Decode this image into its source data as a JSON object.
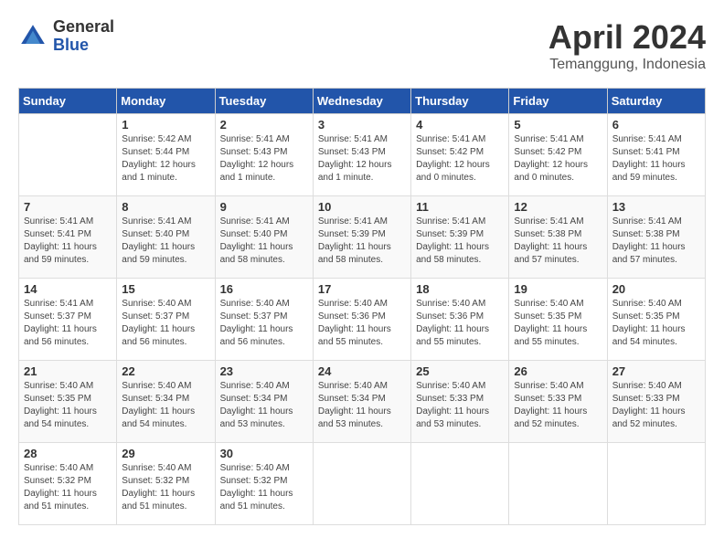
{
  "header": {
    "logo_general": "General",
    "logo_blue": "Blue",
    "month_title": "April 2024",
    "location": "Temanggung, Indonesia"
  },
  "calendar": {
    "days_of_week": [
      "Sunday",
      "Monday",
      "Tuesday",
      "Wednesday",
      "Thursday",
      "Friday",
      "Saturday"
    ],
    "weeks": [
      [
        {
          "day": "",
          "sunrise": "",
          "sunset": "",
          "daylight": ""
        },
        {
          "day": "1",
          "sunrise": "Sunrise: 5:42 AM",
          "sunset": "Sunset: 5:44 PM",
          "daylight": "Daylight: 12 hours and 1 minute."
        },
        {
          "day": "2",
          "sunrise": "Sunrise: 5:41 AM",
          "sunset": "Sunset: 5:43 PM",
          "daylight": "Daylight: 12 hours and 1 minute."
        },
        {
          "day": "3",
          "sunrise": "Sunrise: 5:41 AM",
          "sunset": "Sunset: 5:43 PM",
          "daylight": "Daylight: 12 hours and 1 minute."
        },
        {
          "day": "4",
          "sunrise": "Sunrise: 5:41 AM",
          "sunset": "Sunset: 5:42 PM",
          "daylight": "Daylight: 12 hours and 0 minutes."
        },
        {
          "day": "5",
          "sunrise": "Sunrise: 5:41 AM",
          "sunset": "Sunset: 5:42 PM",
          "daylight": "Daylight: 12 hours and 0 minutes."
        },
        {
          "day": "6",
          "sunrise": "Sunrise: 5:41 AM",
          "sunset": "Sunset: 5:41 PM",
          "daylight": "Daylight: 11 hours and 59 minutes."
        }
      ],
      [
        {
          "day": "7",
          "sunrise": "Sunrise: 5:41 AM",
          "sunset": "Sunset: 5:41 PM",
          "daylight": "Daylight: 11 hours and 59 minutes."
        },
        {
          "day": "8",
          "sunrise": "Sunrise: 5:41 AM",
          "sunset": "Sunset: 5:40 PM",
          "daylight": "Daylight: 11 hours and 59 minutes."
        },
        {
          "day": "9",
          "sunrise": "Sunrise: 5:41 AM",
          "sunset": "Sunset: 5:40 PM",
          "daylight": "Daylight: 11 hours and 58 minutes."
        },
        {
          "day": "10",
          "sunrise": "Sunrise: 5:41 AM",
          "sunset": "Sunset: 5:39 PM",
          "daylight": "Daylight: 11 hours and 58 minutes."
        },
        {
          "day": "11",
          "sunrise": "Sunrise: 5:41 AM",
          "sunset": "Sunset: 5:39 PM",
          "daylight": "Daylight: 11 hours and 58 minutes."
        },
        {
          "day": "12",
          "sunrise": "Sunrise: 5:41 AM",
          "sunset": "Sunset: 5:38 PM",
          "daylight": "Daylight: 11 hours and 57 minutes."
        },
        {
          "day": "13",
          "sunrise": "Sunrise: 5:41 AM",
          "sunset": "Sunset: 5:38 PM",
          "daylight": "Daylight: 11 hours and 57 minutes."
        }
      ],
      [
        {
          "day": "14",
          "sunrise": "Sunrise: 5:41 AM",
          "sunset": "Sunset: 5:37 PM",
          "daylight": "Daylight: 11 hours and 56 minutes."
        },
        {
          "day": "15",
          "sunrise": "Sunrise: 5:40 AM",
          "sunset": "Sunset: 5:37 PM",
          "daylight": "Daylight: 11 hours and 56 minutes."
        },
        {
          "day": "16",
          "sunrise": "Sunrise: 5:40 AM",
          "sunset": "Sunset: 5:37 PM",
          "daylight": "Daylight: 11 hours and 56 minutes."
        },
        {
          "day": "17",
          "sunrise": "Sunrise: 5:40 AM",
          "sunset": "Sunset: 5:36 PM",
          "daylight": "Daylight: 11 hours and 55 minutes."
        },
        {
          "day": "18",
          "sunrise": "Sunrise: 5:40 AM",
          "sunset": "Sunset: 5:36 PM",
          "daylight": "Daylight: 11 hours and 55 minutes."
        },
        {
          "day": "19",
          "sunrise": "Sunrise: 5:40 AM",
          "sunset": "Sunset: 5:35 PM",
          "daylight": "Daylight: 11 hours and 55 minutes."
        },
        {
          "day": "20",
          "sunrise": "Sunrise: 5:40 AM",
          "sunset": "Sunset: 5:35 PM",
          "daylight": "Daylight: 11 hours and 54 minutes."
        }
      ],
      [
        {
          "day": "21",
          "sunrise": "Sunrise: 5:40 AM",
          "sunset": "Sunset: 5:35 PM",
          "daylight": "Daylight: 11 hours and 54 minutes."
        },
        {
          "day": "22",
          "sunrise": "Sunrise: 5:40 AM",
          "sunset": "Sunset: 5:34 PM",
          "daylight": "Daylight: 11 hours and 54 minutes."
        },
        {
          "day": "23",
          "sunrise": "Sunrise: 5:40 AM",
          "sunset": "Sunset: 5:34 PM",
          "daylight": "Daylight: 11 hours and 53 minutes."
        },
        {
          "day": "24",
          "sunrise": "Sunrise: 5:40 AM",
          "sunset": "Sunset: 5:34 PM",
          "daylight": "Daylight: 11 hours and 53 minutes."
        },
        {
          "day": "25",
          "sunrise": "Sunrise: 5:40 AM",
          "sunset": "Sunset: 5:33 PM",
          "daylight": "Daylight: 11 hours and 53 minutes."
        },
        {
          "day": "26",
          "sunrise": "Sunrise: 5:40 AM",
          "sunset": "Sunset: 5:33 PM",
          "daylight": "Daylight: 11 hours and 52 minutes."
        },
        {
          "day": "27",
          "sunrise": "Sunrise: 5:40 AM",
          "sunset": "Sunset: 5:33 PM",
          "daylight": "Daylight: 11 hours and 52 minutes."
        }
      ],
      [
        {
          "day": "28",
          "sunrise": "Sunrise: 5:40 AM",
          "sunset": "Sunset: 5:32 PM",
          "daylight": "Daylight: 11 hours and 51 minutes."
        },
        {
          "day": "29",
          "sunrise": "Sunrise: 5:40 AM",
          "sunset": "Sunset: 5:32 PM",
          "daylight": "Daylight: 11 hours and 51 minutes."
        },
        {
          "day": "30",
          "sunrise": "Sunrise: 5:40 AM",
          "sunset": "Sunset: 5:32 PM",
          "daylight": "Daylight: 11 hours and 51 minutes."
        },
        {
          "day": "",
          "sunrise": "",
          "sunset": "",
          "daylight": ""
        },
        {
          "day": "",
          "sunrise": "",
          "sunset": "",
          "daylight": ""
        },
        {
          "day": "",
          "sunrise": "",
          "sunset": "",
          "daylight": ""
        },
        {
          "day": "",
          "sunrise": "",
          "sunset": "",
          "daylight": ""
        }
      ]
    ]
  }
}
